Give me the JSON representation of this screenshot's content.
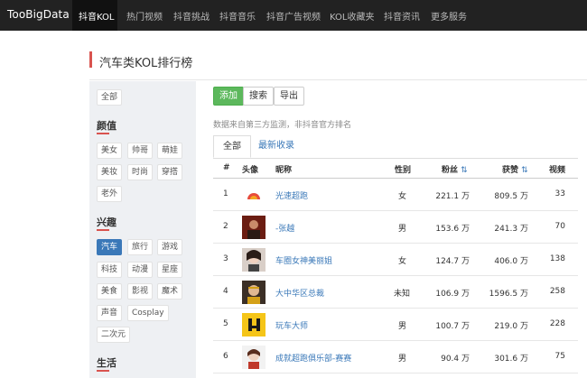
{
  "nav": {
    "brand": "TooBigData",
    "items": [
      {
        "label": "抖音KOL",
        "active": true
      },
      {
        "label": "热门视频"
      },
      {
        "label": "抖音挑战"
      },
      {
        "label": "抖音音乐"
      },
      {
        "label": "抖音广告视频"
      },
      {
        "label": "KOL收藏夹"
      },
      {
        "label": "抖音资讯"
      },
      {
        "label": "更多服务"
      }
    ]
  },
  "page": {
    "title": "汽车类KOL排行榜"
  },
  "sidebar": {
    "all": "全部",
    "groups": [
      {
        "title": "颜值",
        "chips": [
          "美女",
          "帅哥",
          "萌娃",
          "美妆",
          "时尚",
          "穿搭",
          "老外"
        ]
      },
      {
        "title": "兴趣",
        "chips": [
          "汽车",
          "旅行",
          "游戏",
          "科技",
          "动漫",
          "星座",
          "美食",
          "影视",
          "魔术",
          "声音",
          "Cosplay",
          "二次元"
        ],
        "active": "汽车"
      },
      {
        "title": "生活"
      }
    ]
  },
  "toolbar": {
    "add": "添加",
    "search": "搜索",
    "export": "导出"
  },
  "note": "数据来自第三方监测，非抖音官方排名",
  "tabs": [
    "全部",
    "最新收录"
  ],
  "table": {
    "headers": {
      "rank": "#",
      "avatar": "头像",
      "name": "昵称",
      "gender": "性别",
      "fans": "粉丝",
      "likes": "获赞",
      "videos": "视频"
    },
    "rows": [
      {
        "rank": "1",
        "name": "光速超跑",
        "gender": "女",
        "fans": "221.1 万",
        "likes": "809.5 万",
        "videos": "33"
      },
      {
        "rank": "2",
        "name": "-张越",
        "gender": "男",
        "fans": "153.6 万",
        "likes": "241.3 万",
        "videos": "70"
      },
      {
        "rank": "3",
        "name": "车圈女神美丽姐",
        "gender": "女",
        "fans": "124.7 万",
        "likes": "406.0 万",
        "videos": "138"
      },
      {
        "rank": "4",
        "name": "大中华区总裁",
        "gender": "未知",
        "fans": "106.9 万",
        "likes": "1596.5 万",
        "videos": "258"
      },
      {
        "rank": "5",
        "name": "玩车大师",
        "gender": "男",
        "fans": "100.7 万",
        "likes": "219.0 万",
        "videos": "228"
      },
      {
        "rank": "6",
        "name": "成就超跑俱乐部-赛赛",
        "gender": "男",
        "fans": "90.4 万",
        "likes": "301.6 万",
        "videos": "75"
      }
    ]
  },
  "colors": {
    "accent": "#3a78b8",
    "add_button": "#5cb85c",
    "title_marker": "#d9534f",
    "nav_bg": "#222222"
  }
}
